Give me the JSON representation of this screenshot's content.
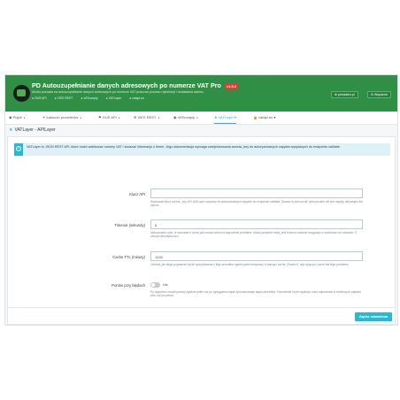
{
  "header": {
    "title": "PD Autouzupełnianie danych adresowych po numerze VAT Pro",
    "version_badge": "v1.0.2",
    "subtitle": "Moduł pozwala na autouzupełnianie danych adresowych po numerze VAT podczas procesu rejestracji i dodawania adresu",
    "links": [
      "GUS API",
      "VIES REST",
      "VATcomply",
      "VATLayer",
      "vatapi.eu"
    ],
    "btn_site": "prestalen.pl",
    "btn_support": "Wsparcie"
  },
  "tabs": [
    {
      "label": "Pulpit",
      "icon": "car-icon"
    },
    {
      "label": "Łańcuch providerów",
      "icon": "link-icon"
    },
    {
      "label": "GUS API",
      "icon": "flag-icon"
    },
    {
      "label": "VIES REST",
      "icon": "globe-icon"
    },
    {
      "label": "VATcomply",
      "icon": "car-icon"
    },
    {
      "label": "VATLayer",
      "icon": "star-icon"
    },
    {
      "label": "vatapi.eu",
      "icon": "lock-icon"
    }
  ],
  "card": {
    "title": "VATLayer - APILayer"
  },
  "alert": {
    "text": "VATLayer to JSON REST API, które może walidować numery VAT i zwracać informacje o firmie. Jego dokumentacja wymaga zarejestrowania access_key do autoryzowanych zapytań wysyłanych do endpointu validate."
  },
  "form": {
    "api_key_label": "Klucz API",
    "api_key_value": "",
    "api_key_help": "Wprowadź klucz access_key API VATLayer używany do autoryzowanych zapytań do endpointu validate. Zostaw to pole puste, jeśli provider nie jest między aktywnymi lub innymi.",
    "timeout_label": "Timeout (sekundy)",
    "timeout_value": "6",
    "timeout_help": "Maksymalny czas, w sekundach, przez jaki moduł czeka na odpowiedź providera. Moduł przejdzie dalej, jeśli timeout zostanie osiągnięty w zależności od ustawień. 5 sekund dla większości.",
    "cache_label": "Cache TTL (minuty)",
    "cache_value": "1440",
    "cache_help": "Określa, jak długo poprawnie wynik wyszukiwania z tego providera będzie przechowywany w pamięci cache. Zostaw 0, aby wyłączyć cache dla tego providera.",
    "retry_label": "Ponów przy błędach",
    "retry_value": "Nie",
    "retry_help": "Po włączeniu moduł ponowi żądanie jeden raz po wystąpieniu błędu tymczasowego błędu providera. Ponowienie może wydłużyć czas odpowiedzi w chwilowych błędach sieci lub providera."
  },
  "footer": {
    "save_label": "Zapisz ustawienia"
  },
  "colors": {
    "header_green": "#2f8f45",
    "accent": "#25b9d7",
    "badge_red": "#e53935"
  }
}
